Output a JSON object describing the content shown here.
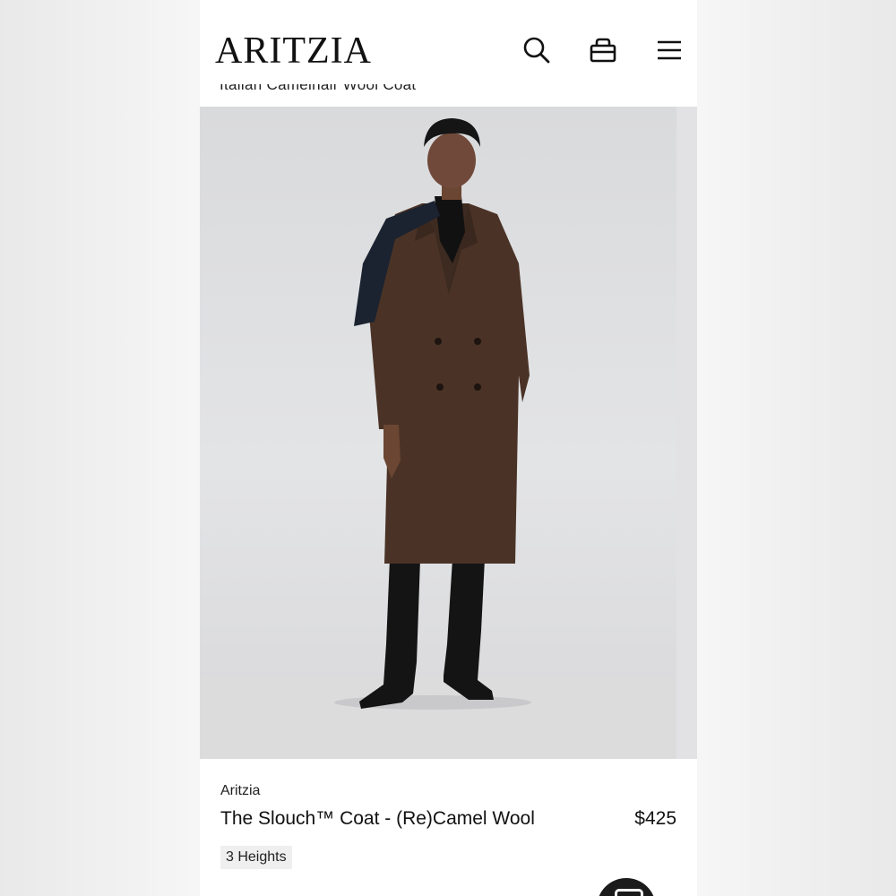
{
  "header": {
    "logo": "ARITZIA",
    "partial_title": "Italian Camelhair Wool Coat",
    "icons": [
      "search-icon",
      "bag-icon",
      "menu-icon"
    ]
  },
  "product": {
    "brand": "Aritzia",
    "name": "The Slouch™ Coat - (Re)Camel Wool",
    "price": "$425",
    "badge": "3 Heights"
  },
  "colors": {
    "coat": "#4a3326",
    "background": "#ffffff",
    "badge_bg": "#efefef",
    "fab": "#1b1b1b"
  }
}
